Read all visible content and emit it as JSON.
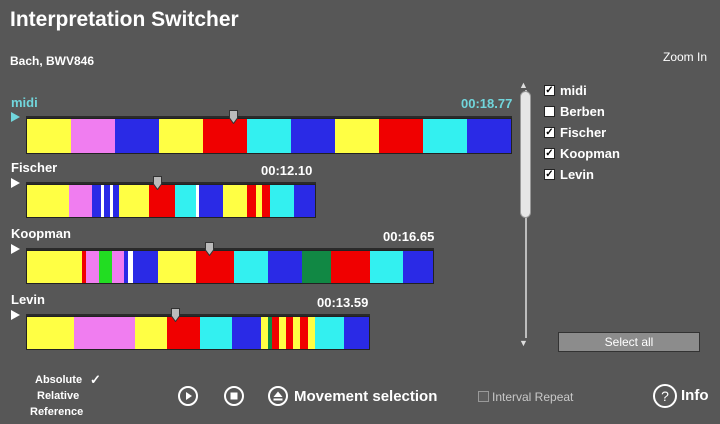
{
  "app": {
    "title": "Interpretation Switcher",
    "piece": "Bach, BWV846",
    "zoom_label": "Zoom In"
  },
  "tracks": [
    {
      "name": "midi",
      "time": "00:18.77",
      "highlight_color": "#71d6dc",
      "playhead_fraction": 0.43,
      "segments": [
        {
          "color": "#ffff44",
          "w": 0.09
        },
        {
          "color": "#f07df0",
          "w": 0.09
        },
        {
          "color": "#2a2ae6",
          "w": 0.09
        },
        {
          "color": "#ffff44",
          "w": 0.09
        },
        {
          "color": "#f00000",
          "w": 0.09
        },
        {
          "color": "#33f0f0",
          "w": 0.09
        },
        {
          "color": "#2a2ae6",
          "w": 0.09
        },
        {
          "color": "#ffff44",
          "w": 0.09
        },
        {
          "color": "#f00000",
          "w": 0.09
        },
        {
          "color": "#33f0f0",
          "w": 0.09
        },
        {
          "color": "#2a2ae6",
          "w": 0.09
        }
      ]
    },
    {
      "name": "Fischer",
      "time": "00:12.10",
      "playhead_fraction": 0.45,
      "segments": [
        {
          "color": "#ffff44",
          "w": 0.14
        },
        {
          "color": "#f07df0",
          "w": 0.08
        },
        {
          "color": "#2a2ae6",
          "w": 0.03
        },
        {
          "color": "#ffffff",
          "w": 0.01
        },
        {
          "color": "#2a2ae6",
          "w": 0.02
        },
        {
          "color": "#ffffff",
          "w": 0.01
        },
        {
          "color": "#2a2ae6",
          "w": 0.02
        },
        {
          "color": "#ffff44",
          "w": 0.1
        },
        {
          "color": "#f00000",
          "w": 0.09
        },
        {
          "color": "#33f0f0",
          "w": 0.07
        },
        {
          "color": "#ffffff",
          "w": 0.01
        },
        {
          "color": "#2a2ae6",
          "w": 0.08
        },
        {
          "color": "#ffff44",
          "w": 0.08
        },
        {
          "color": "#f00000",
          "w": 0.03
        },
        {
          "color": "#ffff44",
          "w": 0.02
        },
        {
          "color": "#f00000",
          "w": 0.03
        },
        {
          "color": "#33f0f0",
          "w": 0.08
        },
        {
          "color": "#2a2ae6",
          "w": 0.07
        }
      ]
    },
    {
      "name": "Koopman",
      "time": "00:16.65",
      "playhead_fraction": 0.44,
      "segments": [
        {
          "color": "#ffff44",
          "w": 0.13
        },
        {
          "color": "#f00000",
          "w": 0.01
        },
        {
          "color": "#f07df0",
          "w": 0.03
        },
        {
          "color": "#22dd22",
          "w": 0.03
        },
        {
          "color": "#f07df0",
          "w": 0.03
        },
        {
          "color": "#2a2ae6",
          "w": 0.01
        },
        {
          "color": "#ffffff",
          "w": 0.01
        },
        {
          "color": "#2a2ae6",
          "w": 0.06
        },
        {
          "color": "#ffff44",
          "w": 0.09
        },
        {
          "color": "#f00000",
          "w": 0.09
        },
        {
          "color": "#33f0f0",
          "w": 0.08
        },
        {
          "color": "#2a2ae6",
          "w": 0.08
        },
        {
          "color": "#118844",
          "w": 0.07
        },
        {
          "color": "#f00000",
          "w": 0.09
        },
        {
          "color": "#33f0f0",
          "w": 0.08
        },
        {
          "color": "#2a2ae6",
          "w": 0.07
        }
      ]
    },
    {
      "name": "Levin",
      "time": "00:13.59",
      "playhead_fraction": 0.43,
      "segments": [
        {
          "color": "#ffff44",
          "w": 0.13
        },
        {
          "color": "#f07df0",
          "w": 0.17
        },
        {
          "color": "#ffff44",
          "w": 0.09
        },
        {
          "color": "#f00000",
          "w": 0.09
        },
        {
          "color": "#33f0f0",
          "w": 0.09
        },
        {
          "color": "#2a2ae6",
          "w": 0.08
        },
        {
          "color": "#ffff44",
          "w": 0.02
        },
        {
          "color": "#118844",
          "w": 0.01
        },
        {
          "color": "#f00000",
          "w": 0.02
        },
        {
          "color": "#ffff44",
          "w": 0.02
        },
        {
          "color": "#f00000",
          "w": 0.02
        },
        {
          "color": "#ffff44",
          "w": 0.02
        },
        {
          "color": "#f00000",
          "w": 0.02
        },
        {
          "color": "#ffff44",
          "w": 0.02
        },
        {
          "color": "#33f0f0",
          "w": 0.08
        },
        {
          "color": "#2a2ae6",
          "w": 0.07
        }
      ]
    }
  ],
  "interpretations": [
    {
      "label": "midi",
      "checked": true
    },
    {
      "label": "Berben",
      "checked": false
    },
    {
      "label": "Fischer",
      "checked": true
    },
    {
      "label": "Koopman",
      "checked": true
    },
    {
      "label": "Levin",
      "checked": true
    }
  ],
  "select_all_label": "Select all",
  "modes": {
    "absolute": "Absolute",
    "relative": "Relative",
    "reference": "Reference",
    "selected_check": "✓"
  },
  "controls": {
    "movement_label": "Movement selection",
    "interval_repeat_label": "Interval Repeat",
    "info_label": "Info"
  }
}
